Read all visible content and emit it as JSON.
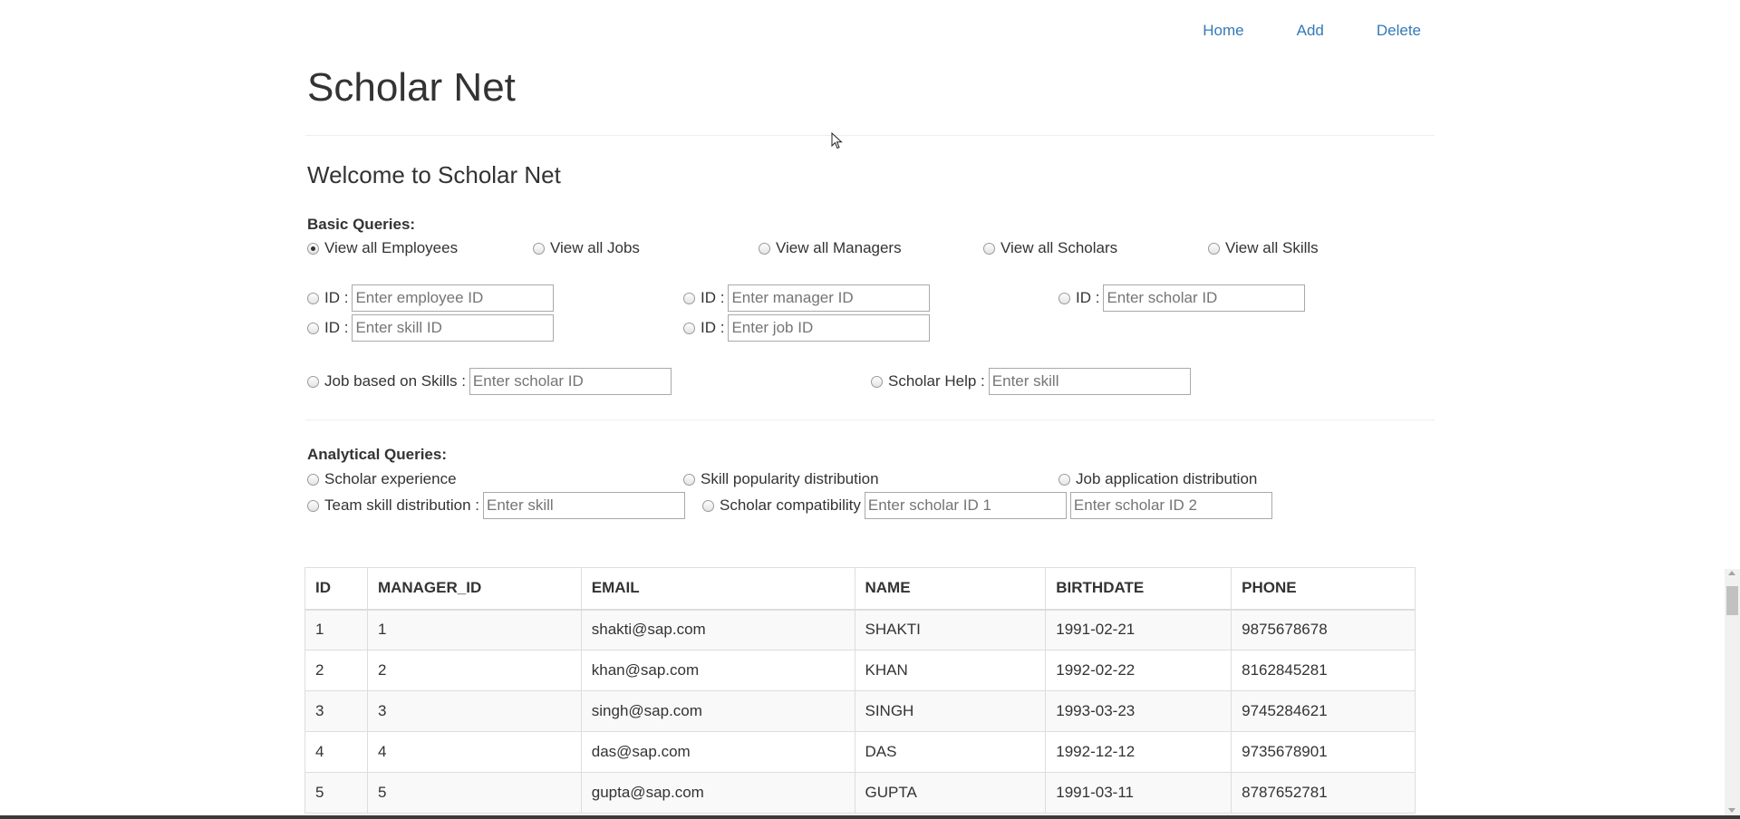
{
  "nav": {
    "home": "Home",
    "add": "Add",
    "delete": "Delete"
  },
  "header": {
    "title": "Scholar Net",
    "welcome": "Welcome to Scholar Net"
  },
  "basic": {
    "label": "Basic Queries:",
    "view_employees": "View all Employees",
    "view_jobs": "View all Jobs",
    "view_managers": "View all Managers",
    "view_scholars": "View all Scholars",
    "view_skills": "View all Skills",
    "id_label": "ID :",
    "employee_id_placeholder": "Enter employee ID",
    "manager_id_placeholder": "Enter manager ID",
    "scholar_id_placeholder": "Enter scholar ID",
    "skill_id_placeholder": "Enter skill ID",
    "job_id_placeholder": "Enter job ID",
    "job_skills_label": "Job based on Skills :",
    "job_skills_placeholder": "Enter scholar ID",
    "scholar_help_label": "Scholar Help :",
    "scholar_help_placeholder": "Enter skill"
  },
  "analytical": {
    "label": "Analytical Queries:",
    "scholar_experience": "Scholar experience",
    "skill_popularity": "Skill popularity distribution",
    "job_application": "Job application distribution",
    "team_skill_label": "Team skill distribution :",
    "team_skill_placeholder": "Enter skill",
    "compat_label": "Scholar compatibility",
    "compat_placeholder_1": "Enter scholar ID 1",
    "compat_placeholder_2": "Enter scholar ID 2"
  },
  "table": {
    "columns": [
      "ID",
      "MANAGER_ID",
      "EMAIL",
      "NAME",
      "BIRTHDATE",
      "PHONE"
    ],
    "rows": [
      [
        "1",
        "1",
        "shakti@sap.com",
        "SHAKTI",
        "1991-02-21",
        "9875678678"
      ],
      [
        "2",
        "2",
        "khan@sap.com",
        "KHAN",
        "1992-02-22",
        "8162845281"
      ],
      [
        "3",
        "3",
        "singh@sap.com",
        "SINGH",
        "1993-03-23",
        "9745284621"
      ],
      [
        "4",
        "4",
        "das@sap.com",
        "DAS",
        "1992-12-12",
        "9735678901"
      ],
      [
        "5",
        "5",
        "gupta@sap.com",
        "GUPTA",
        "1991-03-11",
        "8787652781"
      ]
    ]
  }
}
